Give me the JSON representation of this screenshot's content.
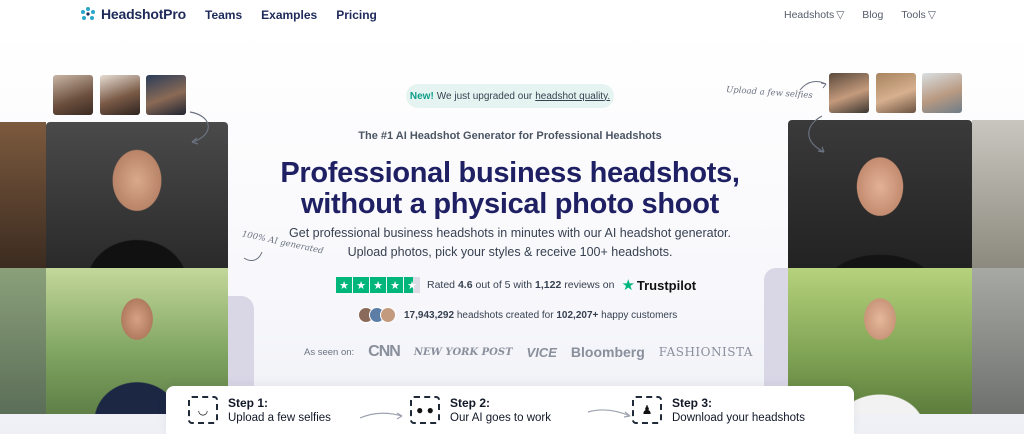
{
  "brand": {
    "name": "HeadshotPro",
    "accent": "#1e2063"
  },
  "nav": {
    "links": [
      "Teams",
      "Examples",
      "Pricing"
    ],
    "right": {
      "headshots": "Headshots",
      "blog": "Blog",
      "tools": "Tools"
    }
  },
  "badge": {
    "new": "New!",
    "text": "We just upgraded our",
    "link": "headshot quality."
  },
  "hero": {
    "eyebrow": "The #1 AI Headshot Generator for Professional Headshots",
    "headline_1": "Professional business headshots,",
    "headline_2": "without a physical photo shoot",
    "sub_1": "Get professional business headshots in minutes with our AI headshot generator.",
    "sub_2": "Upload photos, pick your styles & receive 100+ headshots."
  },
  "rating": {
    "prefix": "Rated",
    "score": "4.6",
    "mid": "out of 5 with",
    "count": "1,122",
    "suffix": "reviews on",
    "provider": "Trustpilot",
    "stars": 4.6
  },
  "stats": {
    "headshots": "17,943,292",
    "mid": "headshots created for",
    "customers": "102,207+",
    "suffix": "happy customers"
  },
  "press": {
    "label": "As seen on:",
    "outlets": [
      "CNN",
      "NEW YORK POST",
      "VICE",
      "Bloomberg",
      "FASHIONISTA"
    ]
  },
  "annotations": {
    "generated": "100% AI generated",
    "upload": "Upload a few selfies"
  },
  "steps": [
    {
      "title": "Step 1:",
      "desc": "Upload a few selfies",
      "icon": "face-scan-icon"
    },
    {
      "title": "Step 2:",
      "desc": "Our AI goes to work",
      "icon": "ai-scan-icon"
    },
    {
      "title": "Step 3:",
      "desc": "Download your headshots",
      "icon": "person-scan-icon"
    }
  ]
}
